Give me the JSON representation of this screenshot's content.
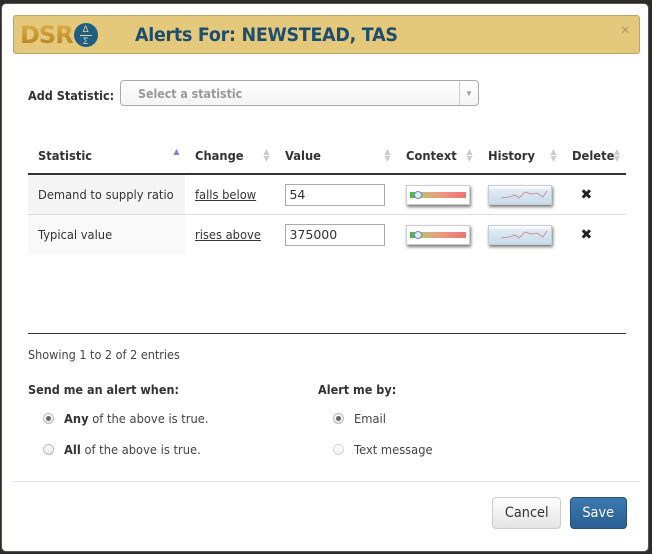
{
  "dialog": {
    "logo_text": "DSR",
    "logo_symbol_top": "Δ",
    "logo_symbol_bottom": "Σ",
    "title": "Alerts For: NEWSTEAD, TAS",
    "close_icon": "×"
  },
  "add_statistic": {
    "label": "Add Statistic:",
    "placeholder": "Select a statistic",
    "arrow_icon": "▼"
  },
  "table": {
    "columns": [
      {
        "label": "Statistic",
        "sort": "ascending"
      },
      {
        "label": "Change",
        "sort": "none"
      },
      {
        "label": "Value",
        "sort": "none"
      },
      {
        "label": "Context",
        "sort": "none"
      },
      {
        "label": "History",
        "sort": "none"
      },
      {
        "label": "Delete",
        "sort": "none"
      }
    ],
    "rows": [
      {
        "statistic": "Demand to supply ratio",
        "change": "falls below",
        "value": "54",
        "context": "context-gauge-thumbnail",
        "history": "history-chart-thumbnail",
        "delete_icon": "✖"
      },
      {
        "statistic": "Typical value",
        "change": "rises above",
        "value": "375000",
        "context": "context-gauge-thumbnail",
        "history": "history-chart-thumbnail",
        "delete_icon": "✖"
      }
    ],
    "sort_icons": {
      "asc": "▲",
      "both_up": "▲",
      "both_down": "▼"
    }
  },
  "info": "Showing 1 to 2 of 2 entries",
  "send_alert": {
    "label": "Send me an alert when:",
    "options": [
      {
        "bold": "Any",
        "rest": " of the above is true.",
        "checked": true
      },
      {
        "bold": "All",
        "rest": " of the above is true.",
        "checked": false
      }
    ]
  },
  "alert_by": {
    "label": "Alert me by:",
    "options": [
      {
        "label": "Email",
        "checked": true,
        "disabled": false
      },
      {
        "label": "Text message",
        "checked": false,
        "disabled": true
      }
    ]
  },
  "footer": {
    "cancel_label": "Cancel",
    "save_label": "Save"
  },
  "colors": {
    "header_bg": "#e4c87c",
    "title": "#1e4e6e",
    "save_bg": "#2a5f94"
  }
}
